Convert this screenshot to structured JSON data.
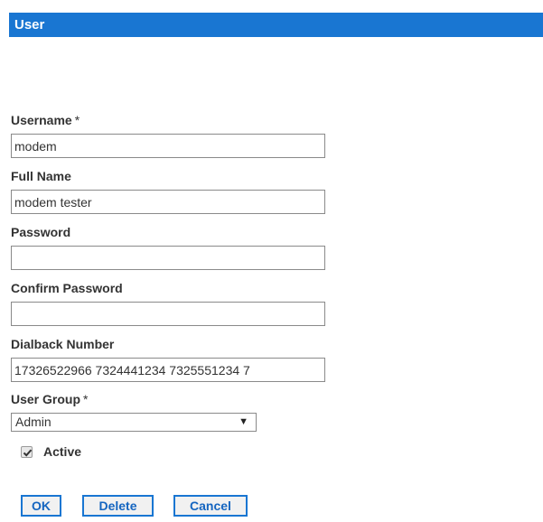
{
  "header": {
    "title": "User",
    "color": "#1976d2"
  },
  "form": {
    "username": {
      "label": "Username",
      "required_mark": "*",
      "value": "modem"
    },
    "full_name": {
      "label": "Full Name",
      "value": "modem tester"
    },
    "password": {
      "label": "Password",
      "value": ""
    },
    "confirm_password": {
      "label": "Confirm Password",
      "value": ""
    },
    "dialback_number": {
      "label": "Dialback Number",
      "value": "17326522966 7324441234 7325551234 7"
    },
    "user_group": {
      "label": "User Group",
      "required_mark": "*",
      "selected": "Admin",
      "icon": "chevron-down-icon"
    },
    "active": {
      "label": "Active",
      "checked": true,
      "icon": "checkmark-icon"
    }
  },
  "buttons": {
    "ok": "OK",
    "delete": "Delete",
    "cancel": "Cancel"
  }
}
